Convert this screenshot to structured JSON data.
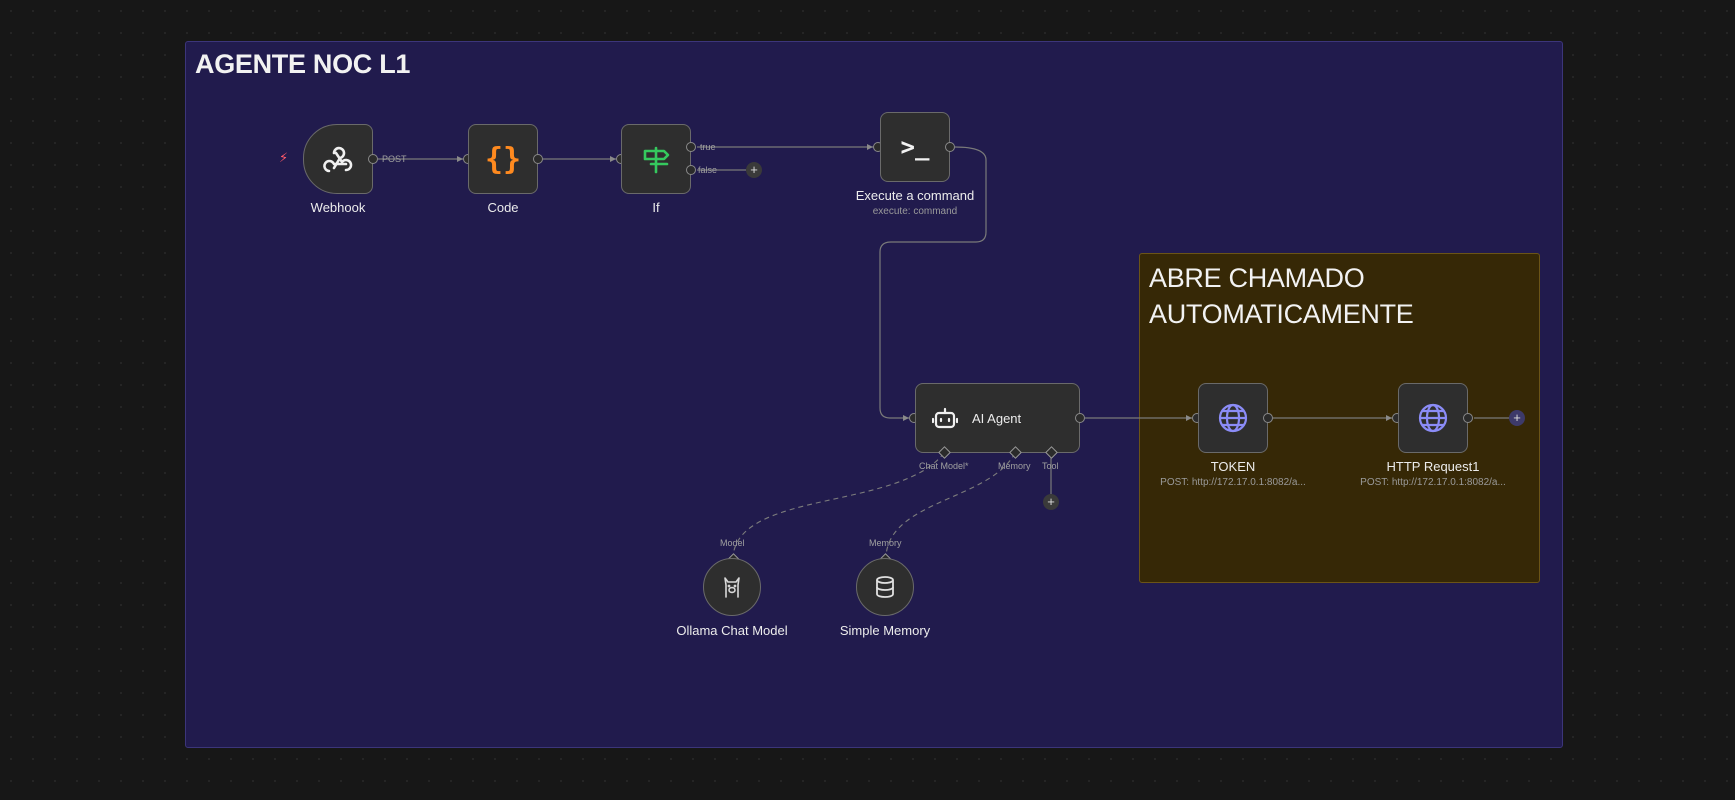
{
  "canvas": {
    "sticky_main_title": "AGENTE NOC L1",
    "sticky_abre_title": "ABRE CHAMADO AUTOMATICAMENTE"
  },
  "nodes": {
    "webhook": {
      "label": "Webhook",
      "output": "POST",
      "icon": "webhook-icon"
    },
    "code": {
      "label": "Code",
      "icon": "code-braces-icon",
      "icon_text": "{}",
      "icon_color": "#ff8a1f"
    },
    "if": {
      "label": "If",
      "true_label": "true",
      "false_label": "false",
      "icon": "signpost-icon",
      "icon_color": "#35c95e"
    },
    "execute": {
      "label": "Execute a command",
      "subtitle": "execute: command",
      "icon": "terminal-icon",
      "icon_text": ">_"
    },
    "agent": {
      "label": "AI Agent",
      "icon": "robot-icon",
      "chat_model": "Chat Model*",
      "memory": "Memory",
      "tool": "Tool"
    },
    "token": {
      "label": "TOKEN",
      "subtitle": "POST: http://172.17.0.1:8082/a...",
      "icon": "globe-icon",
      "icon_color": "#8b8cf7"
    },
    "http": {
      "label": "HTTP Request1",
      "subtitle": "POST: http://172.17.0.1:8082/a...",
      "icon": "globe-icon",
      "icon_color": "#8b8cf7"
    },
    "ollama": {
      "label": "Ollama Chat Model",
      "port": "Model",
      "icon": "llama-icon"
    },
    "memory": {
      "label": "Simple Memory",
      "port": "Memory",
      "icon": "database-icon"
    }
  },
  "colors": {
    "accent_plus": "+",
    "trigger_bolt": "#ff5a6a"
  }
}
